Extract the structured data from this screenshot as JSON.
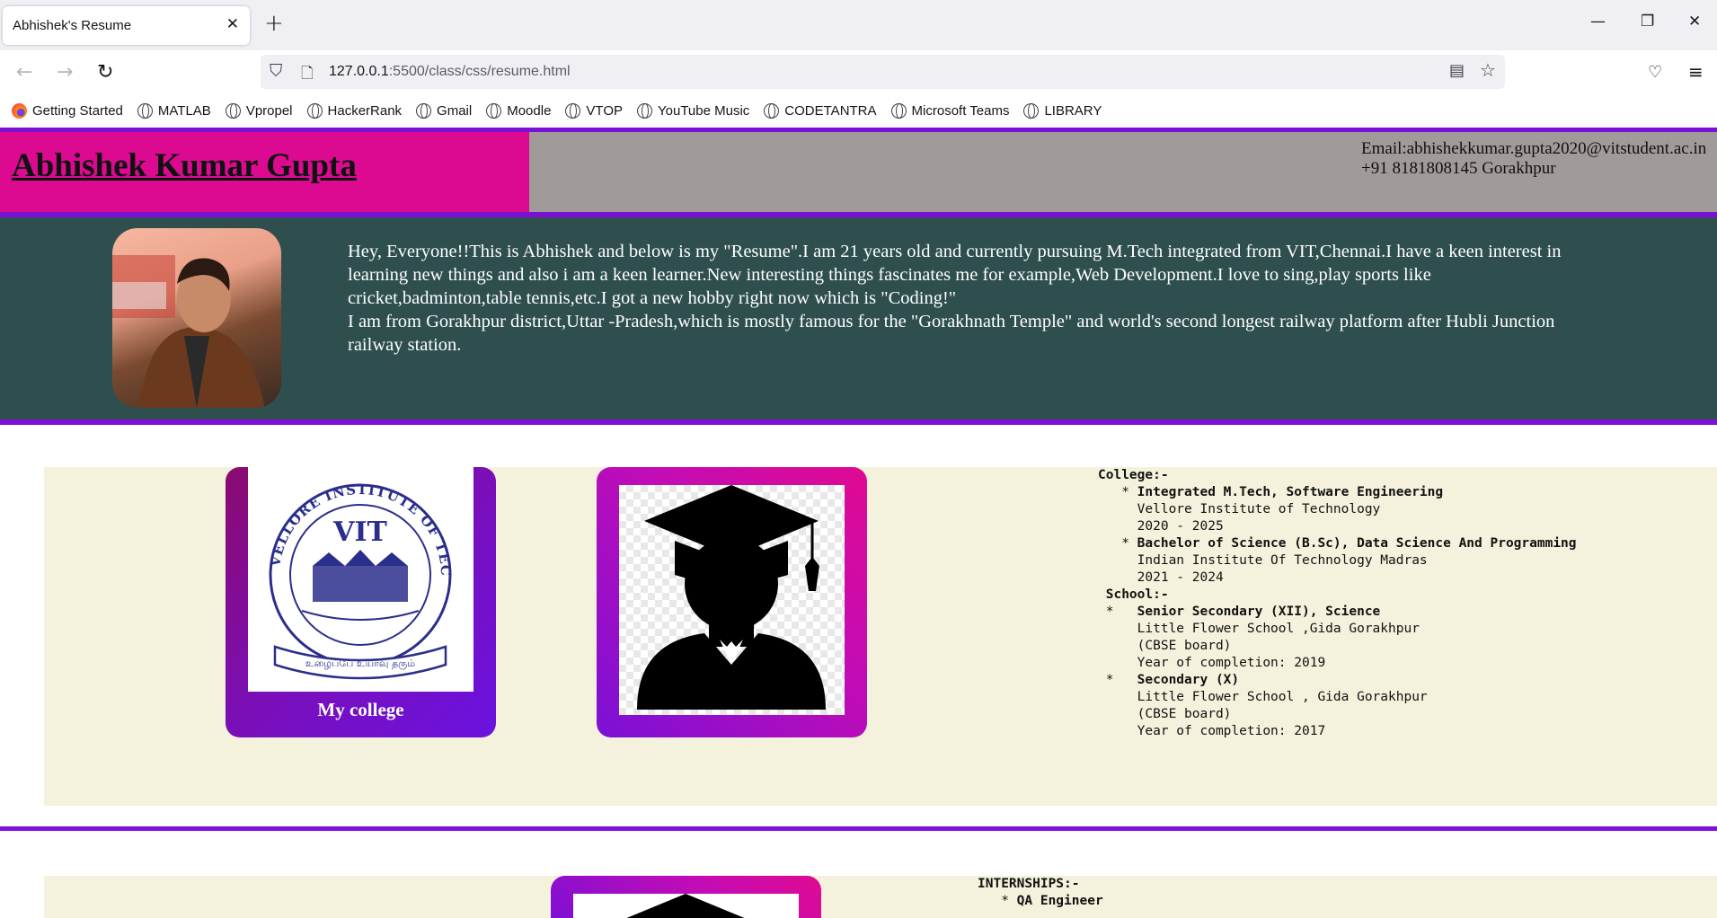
{
  "browser": {
    "tab_title": "Abhishek's Resume",
    "url_host": "127.0.0.1",
    "url_path": ":5500/class/css/resume.html",
    "bookmarks": [
      "Getting Started",
      "MATLAB",
      "Vpropel",
      "HackerRank",
      "Gmail",
      "Moodle",
      "VTOP",
      "YouTube Music",
      "CODETANTRA",
      "Microsoft Teams",
      "LIBRARY"
    ]
  },
  "header": {
    "name": "Abhishek Kumar Gupta",
    "email_line": "Email:abhishekkumar.gupta2020@vitstudent.ac.in",
    "phone_line": "+91 8181808145 Gorakhpur"
  },
  "intro": {
    "paragraph1": "Hey, Everyone!!This is Abhishek and below is my \"Resume\".I am 21 years old and currently pursuing M.Tech integrated from VIT,Chennai.I have a keen interest in learning new things and also i am a keen learner.New interesting things fascinates me for example,Web Development.I love to sing,play sports like cricket,badminton,table tennis,etc.I got a new hobby right now which is \"Coding!\"",
    "paragraph2": "I am from Gorakhpur district,Uttar -Pradesh,which is mostly famous for the \"Gorakhnath Temple\" and world's second longest railway platform after Hubli Junction railway station."
  },
  "education": {
    "college_caption": "My college",
    "logo_text": "VIT",
    "logo_ring_text": "VELLORE INSTITUTE OF TECHNOLOGY",
    "logo_motto": "உழைப்பே உயர்வு தரும்",
    "college_heading": "College:-",
    "college_entries": [
      {
        "title": "Integrated M.Tech, Software Engineering",
        "institution": "Vellore Institute of Technology",
        "years": "2020 - 2025"
      },
      {
        "title": "Bachelor of Science (B.Sc), Data Science And Programming",
        "institution": "Indian Institute Of Technology Madras",
        "years": "2021 - 2024"
      }
    ],
    "school_heading": "School:-",
    "school_entries": [
      {
        "title": "Senior Secondary (XII), Science",
        "institution": "Little Flower School ,Gida Gorakhpur",
        "board": "(CBSE board)",
        "year": "Year of completion: 2019"
      },
      {
        "title": "Secondary (X)",
        "institution": "Little Flower School , Gida Gorakhpur",
        "board": "(CBSE board)",
        "year": "Year of completion: 2017"
      }
    ]
  },
  "internships": {
    "heading": "INTERNSHIPS:-",
    "first_title": "QA Engineer"
  },
  "colors": {
    "accent_purple": "#7b10d6",
    "name_bg": "#db0a91",
    "contact_bg": "#a09a99",
    "intro_bg": "#2f4f4f",
    "section_bg": "#f4f2dc"
  }
}
